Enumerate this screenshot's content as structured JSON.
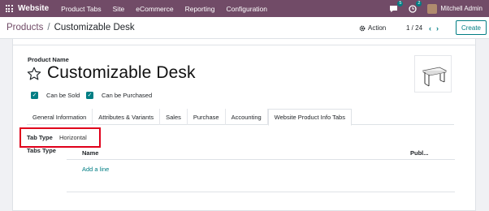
{
  "navbar": {
    "brand": "Website",
    "menu": [
      "Product Tabs",
      "Site",
      "eCommerce",
      "Reporting",
      "Configuration"
    ],
    "chat_badge": "5",
    "activity_badge": "2",
    "user": "Mitchell Admin",
    "color": "#714b67"
  },
  "breadcrumb": {
    "parent": "Products",
    "separator": "/",
    "current": "Customizable Desk"
  },
  "control": {
    "action_label": "Action",
    "pager": "1 / 24",
    "create_label": "Create"
  },
  "form": {
    "product_name_label": "Product Name",
    "product_name": "Customizable Desk",
    "can_be_sold_label": "Can be Sold",
    "can_be_purchased_label": "Can be Purchased",
    "can_be_sold": true,
    "can_be_purchased": true
  },
  "tabs": [
    {
      "label": "General Information"
    },
    {
      "label": "Attributes & Variants"
    },
    {
      "label": "Sales"
    },
    {
      "label": "Purchase"
    },
    {
      "label": "Accounting"
    },
    {
      "label": "Website Product Info Tabs"
    }
  ],
  "tab_content": {
    "tab_type_label": "Tab Type",
    "tab_type_value": "Horizontal",
    "tabs_type_label": "Tabs Type",
    "column_name": "Name",
    "column_publ": "Publ...",
    "add_line": "Add a line"
  },
  "colors": {
    "accent": "#017e84",
    "highlight": "#e0001b"
  }
}
